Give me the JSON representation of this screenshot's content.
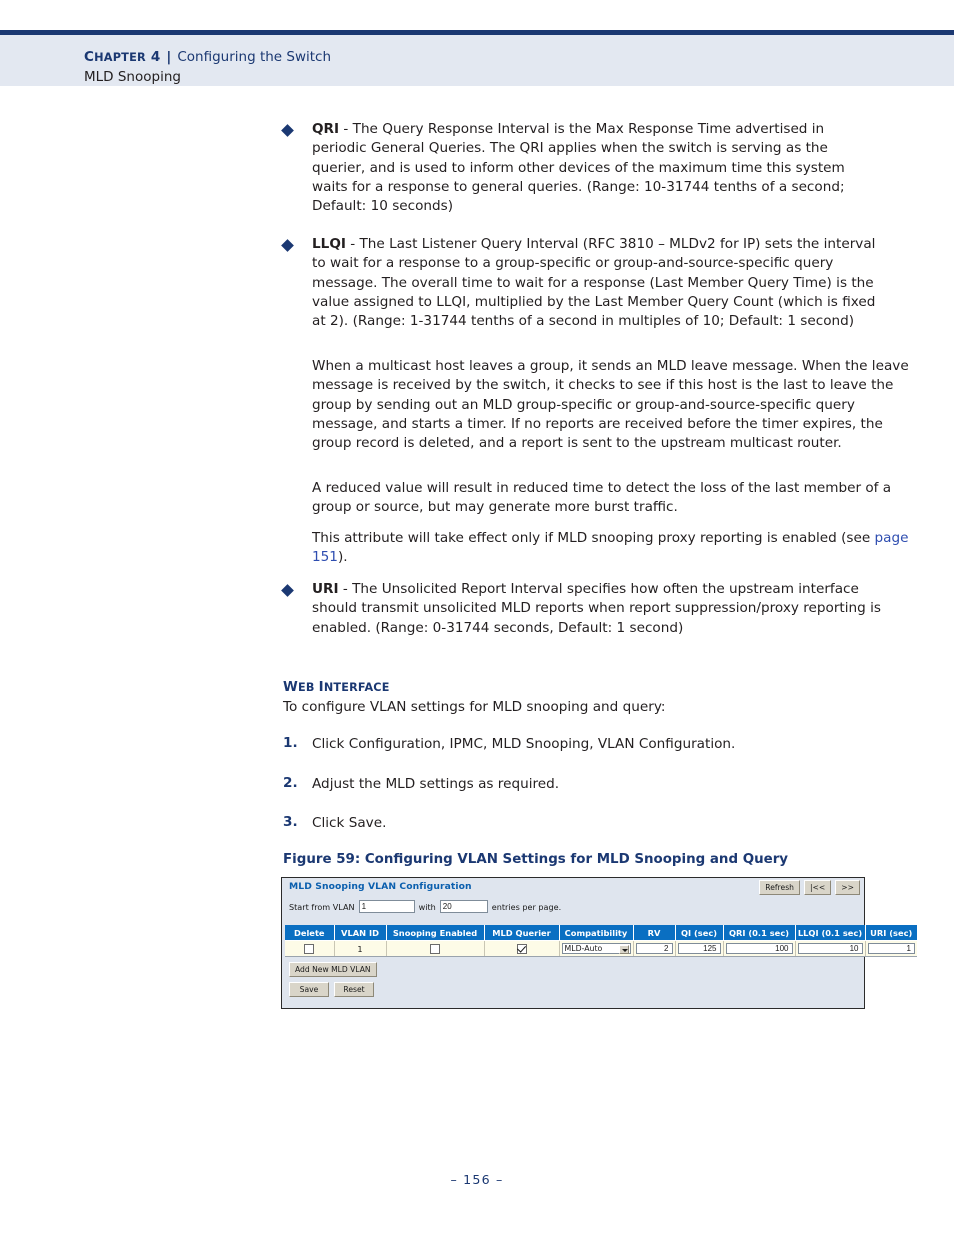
{
  "header": {
    "chapter_prefix": "C",
    "chapter_rest": "HAPTER",
    "chapter_label": "CHAPTER 4",
    "chapter_num": " 4",
    "separator": "|",
    "topic": "Configuring the Switch",
    "subtopic": "MLD Snooping"
  },
  "bullets": [
    {
      "term": "QRI",
      "body": " - The Query Response Interval is the Max Response Time advertised in periodic General Queries. The QRI applies when the switch is serving as the querier, and is used to inform other devices of the maximum time this system waits for a response to general queries. (Range: 10-31744 tenths of a second; Default: 10 seconds)"
    },
    {
      "term": "LLQI",
      "body": " - The Last Listener Query Interval (RFC 3810 – MLDv2 for IP) sets the interval to wait for a response to a group-specific or group-and-source-specific query message. The overall time to wait for a response (Last Member Query Time) is the value assigned to LLQI, multiplied by the Last Member Query Count (which is fixed at 2). (Range: 1-31744 tenths of a second in multiples of 10; Default: 1 second)"
    },
    {
      "term": "URI",
      "body": " - The Unsolicited Report Interval specifies how often the upstream interface should transmit unsolicited MLD reports when report suppression/proxy reporting is enabled. (Range: 0-31744 seconds, Default: 1 second)"
    }
  ],
  "paragraphs": {
    "leave_message": "When a multicast host leaves a group, it sends an MLD leave message. When the leave message is received by the switch, it checks to see if this host is the last to leave the group by sending out an MLD group-specific or group-and-source-specific query message, and starts a timer. If no reports are received before the timer expires, the group record is deleted, and a report is sent to the upstream multicast router.",
    "reduced_value": "A reduced value will result in reduced time to detect the loss of the last member of a group or source, but may generate more burst traffic.",
    "proxy_prefix": "This attribute will take effect only if MLD snooping proxy reporting is enabled (see ",
    "proxy_link": "page 151",
    "proxy_suffix": ")."
  },
  "web_interface": {
    "heading_first": "W",
    "heading_rest1": "EB ",
    "heading_second": "I",
    "heading_rest2": "NTERFACE",
    "heading_full": "WEB INTERFACE",
    "lead": "To configure VLAN settings for MLD snooping and query:",
    "steps": [
      {
        "num": "1.",
        "text": "Click Configuration, IPMC, MLD Snooping, VLAN Configuration."
      },
      {
        "num": "2.",
        "text": "Adjust the MLD settings as required."
      },
      {
        "num": "3.",
        "text": "Click Save."
      }
    ]
  },
  "figure": {
    "caption": "Figure 59:  Configuring VLAN Settings for MLD Snooping and Query",
    "screenshot": {
      "title": "MLD Snooping VLAN Configuration",
      "top_buttons": [
        {
          "name": "refresh",
          "label": "Refresh"
        },
        {
          "name": "first-page",
          "label": "|<<"
        },
        {
          "name": "next-page",
          "label": ">>"
        }
      ],
      "paging": {
        "label_start": "Start from VLAN",
        "vlan_value": "1",
        "label_with": "with",
        "entries_value": "20",
        "label_end": "entries per page."
      },
      "table": {
        "columns": [
          "Delete",
          "VLAN ID",
          "Snooping Enabled",
          "MLD Querier",
          "Compatibility",
          "RV",
          "QI (sec)",
          "QRI (0.1 sec)",
          "LLQI (0.1 sec)",
          "URI (sec)"
        ],
        "rows": [
          {
            "delete_checked": false,
            "vlan_id": "1",
            "snooping_enabled_checked": false,
            "mld_querier_checked": true,
            "compatibility": "MLD-Auto",
            "rv": "2",
            "qi": "125",
            "qri": "100",
            "llqi": "10",
            "uri": "1"
          }
        ]
      },
      "add_button": "Add New MLD VLAN",
      "bottom_buttons": [
        {
          "name": "save",
          "label": "Save"
        },
        {
          "name": "reset",
          "label": "Reset"
        }
      ]
    }
  },
  "footer": {
    "page_number": "–  156  –"
  },
  "colors": {
    "navy": "#1b3872",
    "header_band": "#e3e8f1",
    "link": "#2e4db0",
    "table_header_blue": "#0a6fc2",
    "table_row_cream": "#fdfbe7",
    "screenshot_bg": "#dfe5ee"
  }
}
